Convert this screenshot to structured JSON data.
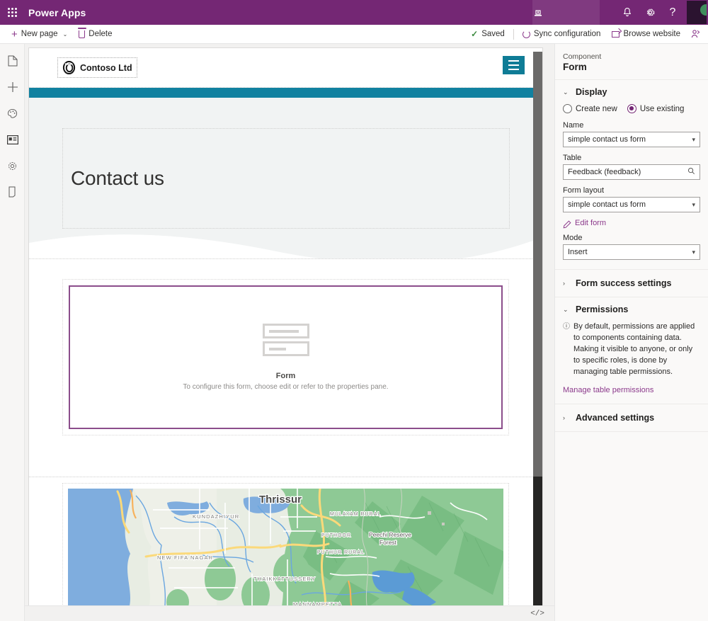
{
  "topbar": {
    "waffle_icon": "app-launcher-waffle-icon",
    "brand": "Power Apps",
    "stamp_icon": "environment-icon",
    "bell_icon": "⌕",
    "notification_icon": "bell-icon",
    "settings_icon": "gear-icon",
    "help_icon": "?",
    "avatar_icon": "user-avatar"
  },
  "commandbar": {
    "new_page_label": "New page",
    "new_page_chevron": "⌄",
    "delete_label": "Delete",
    "saved_label": "Saved",
    "saved_check": "✓",
    "sync_label": "Sync configuration",
    "browse_label": "Browse website",
    "person_icon": "⚹"
  },
  "left_rail": {
    "items": [
      {
        "name": "pages",
        "icon": "page-icon"
      },
      {
        "name": "add-component",
        "icon": "plus-icon"
      },
      {
        "name": "theme",
        "icon": "palette-icon"
      },
      {
        "name": "components",
        "icon": "components-icon"
      },
      {
        "name": "settings",
        "icon": "gear-icon"
      },
      {
        "name": "device-preview",
        "icon": "mobile-icon"
      }
    ]
  },
  "canvas": {
    "site_header": {
      "logo_text": "Contoso Ltd",
      "logo_icon": "contoso-ring-logo",
      "menu_icon": "hamburger-menu-icon",
      "menu_color": "#0f7c96"
    },
    "accent_bar_color": "#1181a0",
    "hero": {
      "title": "Contact us",
      "bg_color": "#f2f4f4"
    },
    "form_component": {
      "icon": "form-placeholder-icon",
      "label": "Form",
      "hint": "To configure this form, choose edit or refer to the properties pane.",
      "selected_border_color": "#8b4d8b"
    },
    "map_component": {
      "icon": "map-component",
      "labels": [
        "Thrissur",
        "KUNDAZHIYUR",
        "NEW FIFA NAGAR",
        "MULAYAM RURAL",
        "PUTHOOR",
        "PUTHUR RURAL",
        "THAIKKATTUSSERY",
        "MANNAMPETTA",
        "Peechi Reserve Forest"
      ]
    },
    "code_icon": "</>"
  },
  "panel": {
    "kicker": "Component",
    "title": "Form",
    "display": {
      "chevron": "⌄",
      "title": "Display",
      "radio_create_new": "Create new",
      "radio_use_existing": "Use existing",
      "selected_radio": "Use existing",
      "name_label": "Name",
      "name_value": "simple contact us form",
      "table_label": "Table",
      "table_value": "Feedback (feedback)",
      "form_layout_label": "Form layout",
      "form_layout_value": "simple contact us form",
      "edit_form_link": "Edit form",
      "mode_label": "Mode",
      "mode_value": "Insert",
      "accent_color": "#742774"
    },
    "form_success": {
      "chevron": "›",
      "title": "Form success settings"
    },
    "permissions": {
      "chevron": "⌄",
      "title": "Permissions",
      "info_icon": "ⓘ",
      "info_text": "By default, permissions are applied to components containing data. Making it visible to anyone, or only to specific roles, is done by managing table permissions.",
      "manage_link": "Manage table permissions"
    },
    "advanced": {
      "chevron": "›",
      "title": "Advanced settings"
    }
  }
}
